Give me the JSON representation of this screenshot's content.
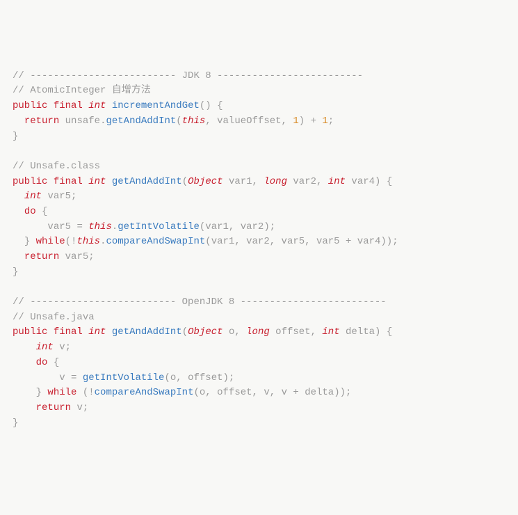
{
  "code": {
    "l1_comment": "// ------------------------- JDK 8 -------------------------",
    "l2_comment": "// AtomicInteger 自增方法",
    "l3_public": "public",
    "l3_final": "final",
    "l3_int": "int",
    "l3_fn": "incrementAndGet",
    "l4_return": "return",
    "l4_unsafe": "unsafe",
    "l4_fn": "getAndAddInt",
    "l4_this": "this",
    "l4_valueOffset": "valueOffset",
    "l4_1a": "1",
    "l4_1b": "1",
    "l6_comment": "// Unsafe.class",
    "l7_public": "public",
    "l7_final": "final",
    "l7_int": "int",
    "l7_fn": "getAndAddInt",
    "l7_Object": "Object",
    "l7_var1": "var1",
    "l7_long": "long",
    "l7_var2": "var2",
    "l7_intp": "int",
    "l7_var4": "var4",
    "l8_int": "int",
    "l8_var5": "var5",
    "l9_do": "do",
    "l10_var5": "var5",
    "l10_this": "this",
    "l10_fn": "getIntVolatile",
    "l10_var1": "var1",
    "l10_var2": "var2",
    "l11_while": "while",
    "l11_this": "this",
    "l11_fn": "compareAndSwapInt",
    "l11_var1": "var1",
    "l11_var2": "var2",
    "l11_var5a": "var5",
    "l11_var5b": "var5",
    "l11_var4": "var4",
    "l12_return": "return",
    "l12_var5": "var5",
    "l14_comment": "// ------------------------- OpenJDK 8 -------------------------",
    "l15_comment": "// Unsafe.java",
    "l16_public": "public",
    "l16_final": "final",
    "l16_int": "int",
    "l16_fn": "getAndAddInt",
    "l16_Object": "Object",
    "l16_o": "o",
    "l16_long": "long",
    "l16_offset": "offset",
    "l16_intp": "int",
    "l16_delta": "delta",
    "l17_int": "int",
    "l17_v": "v",
    "l18_do": "do",
    "l19_v": "v",
    "l19_fn": "getIntVolatile",
    "l19_o": "o",
    "l19_offset": "offset",
    "l20_while": "while",
    "l20_fn": "compareAndSwapInt",
    "l20_o": "o",
    "l20_offset": "offset",
    "l20_v1": "v",
    "l20_v2": "v",
    "l20_delta": "delta",
    "l21_return": "return",
    "l21_v": "v"
  }
}
